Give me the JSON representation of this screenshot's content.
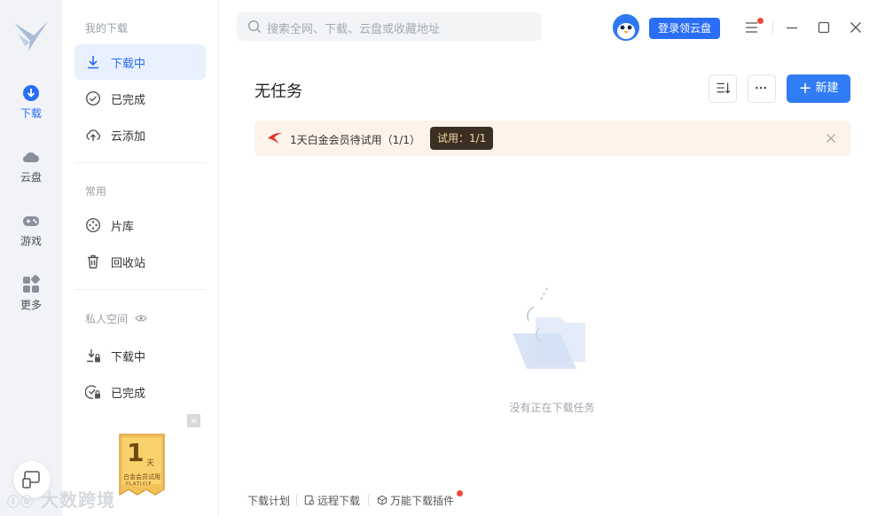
{
  "rail": {
    "items": [
      {
        "label": "下载",
        "icon": "download-icon",
        "active": true
      },
      {
        "label": "云盘",
        "icon": "cloud-icon"
      },
      {
        "label": "游戏",
        "icon": "gamepad-icon"
      },
      {
        "label": "更多",
        "icon": "apps-icon"
      }
    ]
  },
  "sidebar": {
    "section_downloads": "我的下载",
    "downloading": "下载中",
    "completed": "已完成",
    "cloud_add": "云添加",
    "section_common": "常用",
    "library": "片库",
    "recycle": "回收站",
    "section_private": "私人空间",
    "private_downloading": "下载中",
    "private_completed": "已完成",
    "promo_close": "×",
    "promo_days": "1",
    "promo_unit": "天",
    "promo_label": "白金会员试用",
    "promo_sub": "PLATIVIP"
  },
  "header": {
    "search_placeholder": "搜索全网、下载、云盘或收藏地址",
    "login_button": "登录领云盘"
  },
  "main": {
    "title": "无任务",
    "new_button": "新建",
    "banner_text": "1天白金会员待试用（1/1）",
    "banner_badge": "试用：1/1",
    "empty_text": "没有正在下载任务"
  },
  "footer": {
    "plan": "下载计划",
    "remote": "远程下载",
    "plugin": "万能下载插件"
  },
  "watermark": "大数跨境",
  "colors": {
    "accent": "#2a6ef6",
    "rail_bg": "#f1f3f7",
    "banner_bg": "#fdf3ea",
    "badge_bg": "#3b2e22",
    "notify": "#f0483e"
  }
}
